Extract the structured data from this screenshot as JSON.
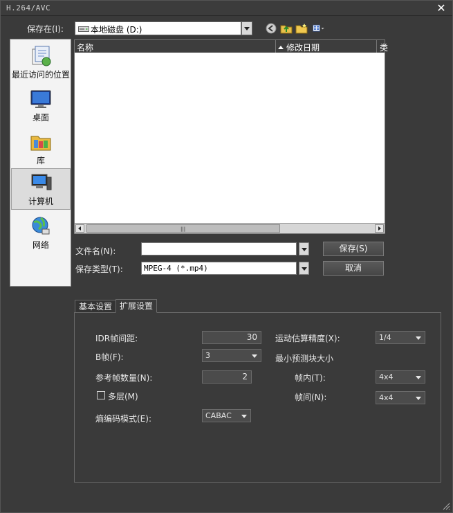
{
  "window": {
    "title": "H.264/AVC"
  },
  "save_in": {
    "label": "保存在(I):",
    "value": "本地磁盘 (D:)"
  },
  "places": [
    {
      "label": "最近访问的位置"
    },
    {
      "label": "桌面"
    },
    {
      "label": "库"
    },
    {
      "label": "计算机"
    },
    {
      "label": "网络"
    }
  ],
  "file_list": {
    "columns": [
      "名称",
      "修改日期",
      "类"
    ]
  },
  "file_name": {
    "label": "文件名(N):",
    "value": ""
  },
  "file_type": {
    "label": "保存类型(T):",
    "value": "MPEG-4 (*.mp4)"
  },
  "buttons": {
    "save": "保存(S)",
    "cancel": "取消"
  },
  "tabs": [
    "基本设置",
    "扩展设置"
  ],
  "settings": {
    "idr_label": "IDR帧间距:",
    "idr_value": "30",
    "bframe_label": "B帧(F):",
    "bframe_value": "3",
    "ref_label": "参考帧数量(N):",
    "ref_value": "2",
    "multilayer_label": "多层(M)",
    "entropy_label": "熵编码模式(E):",
    "entropy_value": "CABAC",
    "motion_label": "运动估算精度(X):",
    "motion_value": "1/4",
    "min_block_label": "最小预测块大小",
    "intra_label": "帧内(T):",
    "intra_value": "4x4",
    "inter_label": "帧间(N):",
    "inter_value": "4x4"
  }
}
